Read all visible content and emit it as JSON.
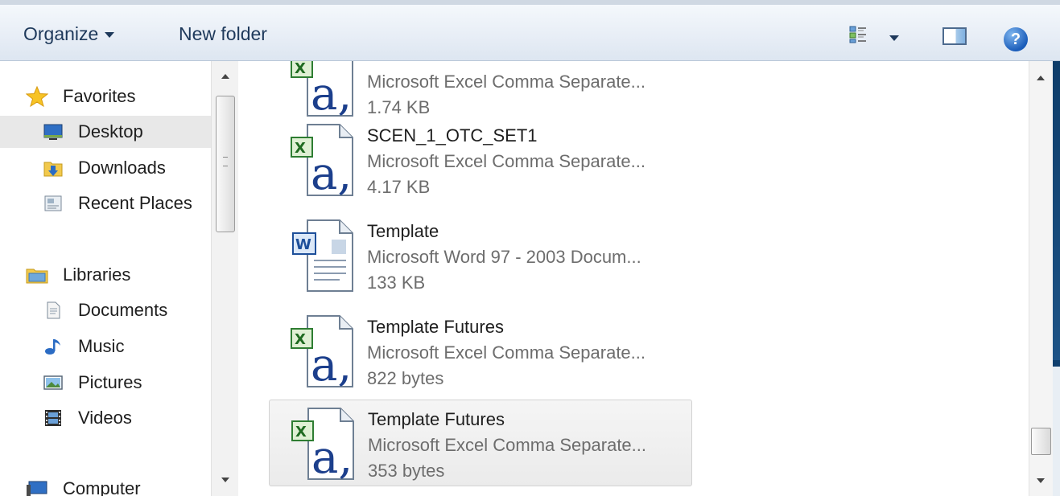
{
  "toolbar": {
    "organize_label": "Organize",
    "new_folder_label": "New folder",
    "views_icon": "views-list-icon",
    "preview_pane_icon": "preview-pane-icon",
    "help_glyph": "?"
  },
  "nav": {
    "favorites": {
      "label": "Favorites",
      "icon": "star-icon"
    },
    "favorites_items": [
      {
        "label": "Desktop",
        "icon": "desktop-icon",
        "selected": true
      },
      {
        "label": "Downloads",
        "icon": "downloads-folder-icon"
      },
      {
        "label": "Recent Places",
        "icon": "recent-places-icon"
      }
    ],
    "libraries": {
      "label": "Libraries",
      "icon": "libraries-folder-icon"
    },
    "library_items": [
      {
        "label": "Documents",
        "icon": "documents-icon"
      },
      {
        "label": "Music",
        "icon": "music-note-icon"
      },
      {
        "label": "Pictures",
        "icon": "pictures-icon"
      },
      {
        "label": "Videos",
        "icon": "videos-film-icon"
      }
    ],
    "computer": {
      "label": "Computer",
      "icon": "computer-icon"
    }
  },
  "files": [
    {
      "name": "",
      "type": "Microsoft Excel Comma Separate...",
      "size": "1.74 KB",
      "icon": "excel-csv-icon",
      "selected": false
    },
    {
      "name": "SCEN_1_OTC_SET1",
      "type": "Microsoft Excel Comma Separate...",
      "size": "4.17 KB",
      "icon": "excel-csv-icon",
      "selected": false
    },
    {
      "name": "Template",
      "type": "Microsoft Word 97 - 2003 Docum...",
      "size": "133 KB",
      "icon": "word-doc-icon",
      "selected": false
    },
    {
      "name": "Template Futures",
      "type": "Microsoft Excel Comma Separate...",
      "size": "822 bytes",
      "icon": "excel-csv-icon",
      "selected": false
    },
    {
      "name": "Template Futures",
      "type": "Microsoft Excel Comma Separate...",
      "size": "353 bytes",
      "icon": "excel-csv-icon",
      "selected": true
    }
  ],
  "colors": {
    "toolbar_text": "#1e395b",
    "secondary_text": "#6d6d6d",
    "selection_bg": "#e8e8e8"
  }
}
